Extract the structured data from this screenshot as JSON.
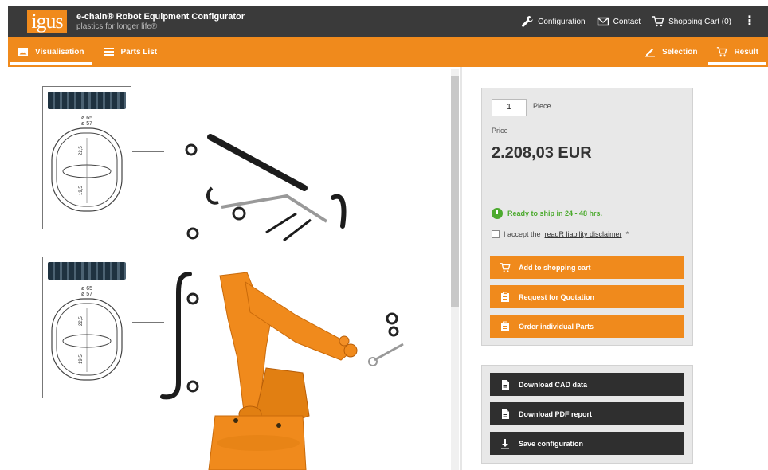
{
  "header": {
    "logo_text": "igus",
    "title": "e-chain® Robot Equipment Configurator",
    "subtitle": "plastics for longer life®",
    "nav": [
      {
        "label": "Configuration",
        "icon": "wrench-icon"
      },
      {
        "label": "Contact",
        "icon": "envelope-icon"
      },
      {
        "label": "Shopping Cart (0)",
        "icon": "cart-icon"
      }
    ],
    "menu_icon": "kebab-menu-icon"
  },
  "tabs": {
    "left": [
      {
        "label": "Visualisation",
        "icon": "image-icon",
        "active": true
      },
      {
        "label": "Parts List",
        "icon": "list-icon",
        "active": false
      }
    ],
    "right": [
      {
        "label": "Selection",
        "icon": "pencil-icon",
        "active": false
      },
      {
        "label": "Result",
        "icon": "cart-icon",
        "active": true
      }
    ]
  },
  "visualization": {
    "cross_sections": [
      {
        "dim_outer": "ø 65",
        "dim_inner": "ø 57",
        "dim_v1": "22,5",
        "dim_v2": "19,5"
      },
      {
        "dim_outer": "ø 65",
        "dim_inner": "ø 57",
        "dim_v1": "22,5",
        "dim_v2": "19,5"
      }
    ],
    "robot_color": "#f08a1c"
  },
  "order": {
    "quantity": "1",
    "quantity_unit": "Piece",
    "price_label": "Price",
    "price": "2.208,03 EUR",
    "shipping": "Ready to ship in 24 - 48 hrs.",
    "disclaimer_prefix": "I accept the",
    "disclaimer_link": "readR liability disclaimer",
    "disclaimer_suffix": "*",
    "actions": [
      {
        "label": "Add to shopping cart",
        "icon": "cart-icon"
      },
      {
        "label": "Request for Quotation",
        "icon": "clipboard-icon"
      },
      {
        "label": "Order individual Parts",
        "icon": "clipboard-icon"
      }
    ],
    "downloads": [
      {
        "label": "Download CAD data",
        "icon": "document-icon"
      },
      {
        "label": "Download PDF report",
        "icon": "document-icon"
      },
      {
        "label": "Save configuration",
        "icon": "download-icon"
      }
    ]
  },
  "colors": {
    "brand_orange": "#f08a1c",
    "header_dark": "#3a3a3a",
    "ready_green": "#4caa2e",
    "button_dark": "#2f2f2f"
  }
}
